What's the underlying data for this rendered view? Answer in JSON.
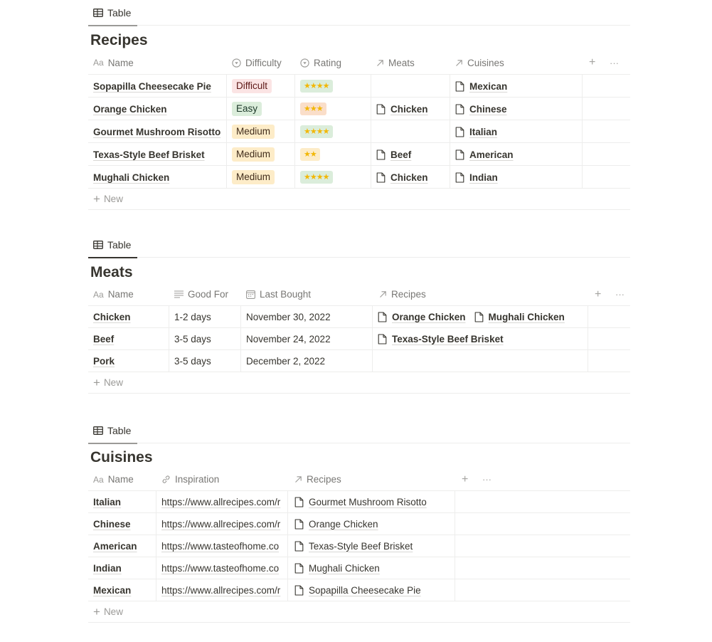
{
  "recipes": {
    "tab_label": "Table",
    "title": "Recipes",
    "columns": [
      {
        "label": "Name",
        "icon": "text-icon"
      },
      {
        "label": "Difficulty",
        "icon": "select-icon"
      },
      {
        "label": "Rating",
        "icon": "select-icon"
      },
      {
        "label": "Meats",
        "icon": "relation-arrow-icon"
      },
      {
        "label": "Cuisines",
        "icon": "relation-arrow-icon"
      }
    ],
    "add_column": "+",
    "more": "···",
    "rows": [
      {
        "name": "Sopapilla Cheesecake Pie",
        "difficulty": "Difficult",
        "difficulty_color": "red",
        "rating": "⭐⭐⭐⭐",
        "rating_stars": 4,
        "rating_color": "green",
        "meats": [],
        "cuisines": [
          "Mexican"
        ]
      },
      {
        "name": "Orange Chicken",
        "difficulty": "Easy",
        "difficulty_color": "green",
        "rating": "⭐⭐⭐",
        "rating_stars": 3,
        "rating_color": "orange",
        "meats": [
          "Chicken"
        ],
        "cuisines": [
          "Chinese"
        ]
      },
      {
        "name": "Gourmet Mushroom Risotto",
        "difficulty": "Medium",
        "difficulty_color": "yellow",
        "rating": "⭐⭐⭐⭐",
        "rating_stars": 4,
        "rating_color": "green",
        "meats": [],
        "cuisines": [
          "Italian"
        ]
      },
      {
        "name": "Texas-Style Beef Brisket",
        "difficulty": "Medium",
        "difficulty_color": "yellow",
        "rating": "⭐⭐",
        "rating_stars": 2,
        "rating_color": "yellow",
        "meats": [
          "Beef"
        ],
        "cuisines": [
          "American"
        ]
      },
      {
        "name": "Mughali Chicken",
        "difficulty": "Medium",
        "difficulty_color": "yellow",
        "rating": "⭐⭐⭐⭐",
        "rating_stars": 4,
        "rating_color": "green",
        "meats": [
          "Chicken"
        ],
        "cuisines": [
          "Indian"
        ]
      }
    ],
    "new_label": "New"
  },
  "meats": {
    "tab_label": "Table",
    "title": "Meats",
    "columns": [
      {
        "label": "Name",
        "icon": "text-icon"
      },
      {
        "label": "Good For",
        "icon": "lines-icon"
      },
      {
        "label": "Last Bought",
        "icon": "calendar-icon"
      },
      {
        "label": "Recipes",
        "icon": "relation-arrow-icon"
      }
    ],
    "add_column": "+",
    "more": "···",
    "rows": [
      {
        "name": "Chicken",
        "good_for": "1-2 days",
        "last_bought": "November 30, 2022",
        "recipes": [
          "Orange Chicken",
          "Mughali Chicken"
        ]
      },
      {
        "name": "Beef",
        "good_for": "3-5 days",
        "last_bought": "November 24, 2022",
        "recipes": [
          "Texas-Style Beef Brisket"
        ]
      },
      {
        "name": "Pork",
        "good_for": "3-5 days",
        "last_bought": "December 2, 2022",
        "recipes": []
      }
    ],
    "new_label": "New"
  },
  "cuisines": {
    "tab_label": "Table",
    "title": "Cuisines",
    "columns": [
      {
        "label": "Name",
        "icon": "text-icon"
      },
      {
        "label": "Inspiration",
        "icon": "link-icon"
      },
      {
        "label": "Recipes",
        "icon": "relation-arrow-icon"
      }
    ],
    "add_column": "+",
    "more": "···",
    "rows": [
      {
        "name": "Italian",
        "inspiration": "https://www.allrecipes.com/r",
        "recipes": [
          "Gourmet Mushroom Risotto"
        ]
      },
      {
        "name": "Chinese",
        "inspiration": "https://www.allrecipes.com/r",
        "recipes": [
          "Orange Chicken"
        ]
      },
      {
        "name": "American",
        "inspiration": "https://www.tasteofhome.co",
        "recipes": [
          "Texas-Style Beef Brisket"
        ]
      },
      {
        "name": "Indian",
        "inspiration": "https://www.tasteofhome.co",
        "recipes": [
          "Mughali Chicken"
        ]
      },
      {
        "name": "Mexican",
        "inspiration": "https://www.allrecipes.com/r",
        "recipes": [
          "Sopapilla Cheesecake Pie"
        ]
      }
    ],
    "new_label": "New"
  },
  "tag_colors": {
    "red": {
      "bg": "#fbe4e4",
      "fg": "#5d1715"
    },
    "green": {
      "bg": "#dbeddb",
      "fg": "#1c3829"
    },
    "yellow": {
      "bg": "#fdecc8",
      "fg": "#402c1b"
    },
    "orange": {
      "bg": "#fadec9",
      "fg": "#49290e"
    }
  }
}
